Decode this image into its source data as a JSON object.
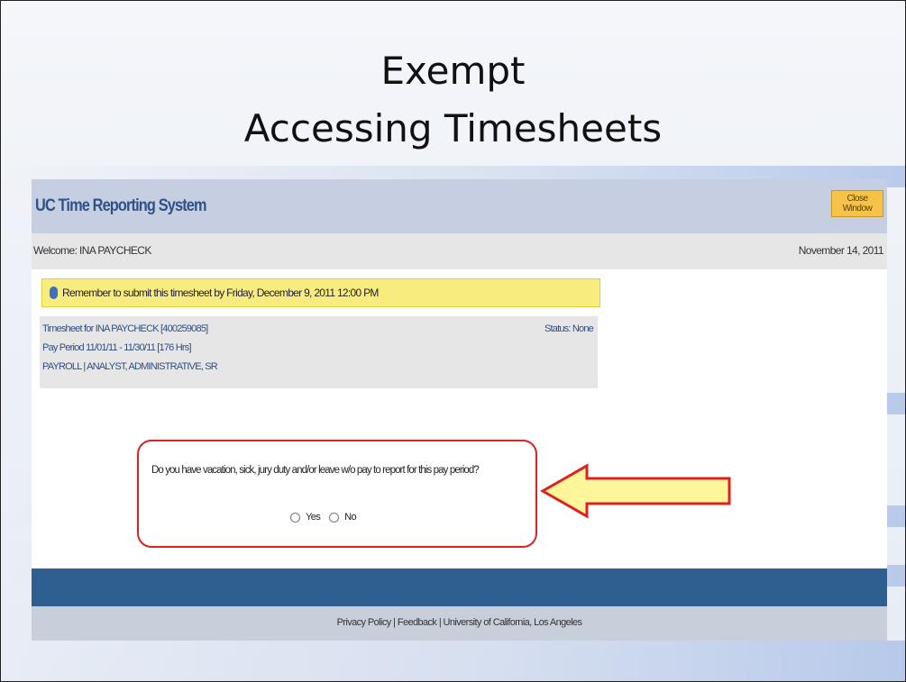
{
  "slide": {
    "title_line1": "Exempt",
    "title_line2": "Accessing Timesheets"
  },
  "app": {
    "title": "UC Time Reporting System",
    "close_button": "Close Window",
    "welcome": "Welcome: INA PAYCHECK",
    "date": "November 14, 2011"
  },
  "notice": {
    "icon": "info-icon",
    "text": "Remember to submit this timesheet by Friday, December 9, 2011 12:00 PM"
  },
  "timesheet": {
    "line1": "Timesheet for INA PAYCHECK [400259085]",
    "line2": "Pay Period 11/01/11 - 11/30/11 [176 Hrs]",
    "line3": "PAYROLL | ANALYST, ADMINISTRATIVE, SR",
    "status": "Status: None"
  },
  "question": {
    "text": "Do you have vacation, sick, jury duty and/or leave w/o pay to report for this pay period?",
    "option_yes": "Yes",
    "option_no": "No"
  },
  "footer": {
    "privacy": "Privacy Policy",
    "sep1": "|",
    "feedback": "Feedback",
    "sep2": "|",
    "university": "University of California, Los Angeles"
  },
  "colors": {
    "app_header": "#c5cfe1",
    "app_title": "#2f5286",
    "close_button": "#f6c247",
    "notice": "#f8ec7f",
    "highlight_border": "#e02020",
    "arrow_fill": "#fff59a",
    "arrow_stroke": "#e02020",
    "footer_blue": "#2f5e91"
  }
}
